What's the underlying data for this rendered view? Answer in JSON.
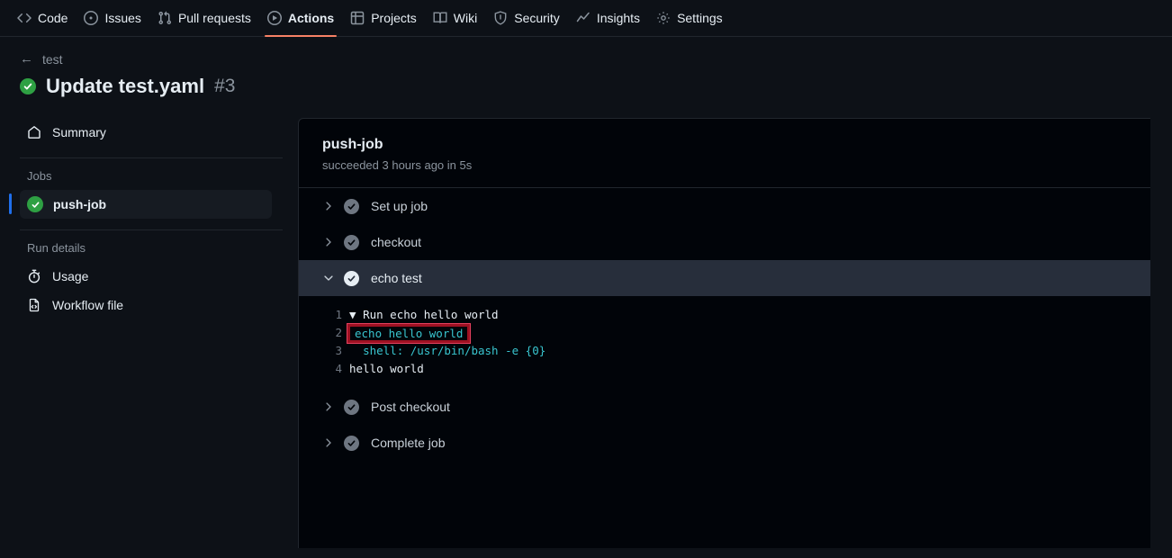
{
  "nav": {
    "items": [
      {
        "label": "Code",
        "icon": "code-icon",
        "active": false
      },
      {
        "label": "Issues",
        "icon": "issue-opened-icon",
        "active": false
      },
      {
        "label": "Pull requests",
        "icon": "git-pull-request-icon",
        "active": false
      },
      {
        "label": "Actions",
        "icon": "play-icon",
        "active": true
      },
      {
        "label": "Projects",
        "icon": "table-icon",
        "active": false
      },
      {
        "label": "Wiki",
        "icon": "book-icon",
        "active": false
      },
      {
        "label": "Security",
        "icon": "shield-icon",
        "active": false
      },
      {
        "label": "Insights",
        "icon": "graph-icon",
        "active": false
      },
      {
        "label": "Settings",
        "icon": "gear-icon",
        "active": false
      }
    ],
    "active_underline_color": "#f78166"
  },
  "pagehead": {
    "back_label": "test",
    "back_arrow": "←",
    "status_icon": "check-circle-icon",
    "status_color": "#2ea043",
    "title": "Update test.yaml",
    "run_number": "#3"
  },
  "sidebar": {
    "summary": {
      "label": "Summary",
      "icon": "home-icon"
    },
    "jobs_title": "Jobs",
    "jobs": [
      {
        "label": "push-job",
        "icon": "check-circle-icon",
        "selected": true,
        "indicator_color": "#1f6feb"
      }
    ],
    "run_details_title": "Run details",
    "details": [
      {
        "label": "Usage",
        "icon": "stopwatch-icon"
      },
      {
        "label": "Workflow file",
        "icon": "file-code-icon"
      }
    ]
  },
  "job": {
    "title": "push-job",
    "status_line": "succeeded 3 hours ago in 5s",
    "steps": [
      {
        "label": "Set up job",
        "expanded": false,
        "icon": "check-circle-icon",
        "chevron": "chevron-right-icon"
      },
      {
        "label": "checkout",
        "expanded": false,
        "icon": "check-circle-icon",
        "chevron": "chevron-right-icon"
      },
      {
        "label": "echo test",
        "expanded": true,
        "icon": "check-circle-icon",
        "chevron": "chevron-down-icon"
      },
      {
        "label": "Post checkout",
        "expanded": false,
        "icon": "check-circle-icon",
        "chevron": "chevron-right-icon"
      },
      {
        "label": "Complete job",
        "expanded": false,
        "icon": "check-circle-icon",
        "chevron": "chevron-right-icon"
      }
    ],
    "log": {
      "lines": [
        {
          "num": "1",
          "text": "Run echo hello world",
          "prefix": "▼ ",
          "style": "plain",
          "highlight": false
        },
        {
          "num": "2",
          "text": "echo hello world",
          "prefix": "",
          "style": "cyan",
          "highlight": true
        },
        {
          "num": "3",
          "text": "shell: /usr/bin/bash -e {0}",
          "prefix": "",
          "style": "cyan",
          "highlight": false
        },
        {
          "num": "4",
          "text": "hello world",
          "prefix": "",
          "style": "plain",
          "highlight": false
        }
      ],
      "highlight_border_color": "#e5405e"
    }
  }
}
